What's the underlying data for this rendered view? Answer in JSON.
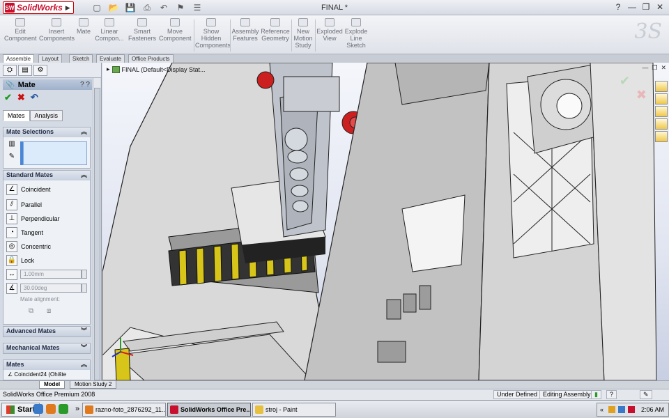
{
  "app": {
    "logo": "SolidWorks",
    "document_title": "FINAL *",
    "help": "?",
    "minimize": "—",
    "restore": "❐",
    "close": "✕"
  },
  "command_manager": {
    "items": [
      {
        "label": "Edit Component"
      },
      {
        "label": "Insert Components"
      },
      {
        "label": "Mate"
      },
      {
        "label": "Linear Compon..."
      },
      {
        "label": "Smart Fasteners"
      },
      {
        "label": "Move Component"
      },
      {
        "label": "Show Hidden Components"
      },
      {
        "label": "Assembly Features"
      },
      {
        "label": "Reference Geometry"
      },
      {
        "label": "New Motion Study"
      },
      {
        "label": "Exploded View"
      },
      {
        "label": "Explode Line Sketch"
      }
    ],
    "tabs": [
      "Assemble",
      "Layout",
      "Sketch",
      "Evaluate",
      "Office Products"
    ]
  },
  "property_manager": {
    "title": "Mate",
    "help_icons": "? ?",
    "ok": "✔",
    "cancel": "✖",
    "undo": "↶",
    "subtabs": [
      "Mates",
      "Analysis"
    ],
    "sections": {
      "mate_selections": "Mate Selections",
      "standard_mates": "Standard Mates",
      "advanced_mates": "Advanced Mates",
      "mechanical_mates": "Mechanical Mates",
      "mates": "Mates"
    },
    "standard_mates": [
      "Coincident",
      "Parallel",
      "Perpendicular",
      "Tangent",
      "Concentric",
      "Lock"
    ],
    "distance_value": "1.00mm",
    "angle_value": "30.00deg",
    "mate_alignment": "Mate alignment:",
    "mate_list_first": "Coincident24 (Ohište"
  },
  "viewport": {
    "tree_tip": "FINAL  (Default<Display Stat...",
    "confirm_ok": "✔",
    "confirm_cancel": "✖"
  },
  "bottom_tabs": [
    "Model",
    "Motion Study 2"
  ],
  "status": {
    "left": "SolidWorks Office Premium 2008",
    "under_defined": "Under Defined",
    "editing": "Editing Assembly",
    "question": "?"
  },
  "taskbar": {
    "start": "Start",
    "quick_launch_arrow": "»",
    "buttons": [
      {
        "label": "razno-foto_2876292_11..."
      },
      {
        "label": "SolidWorks Office Pre..."
      },
      {
        "label": "stroj - Paint"
      }
    ],
    "tray_chevron": "«",
    "time": "2:06 AM"
  }
}
